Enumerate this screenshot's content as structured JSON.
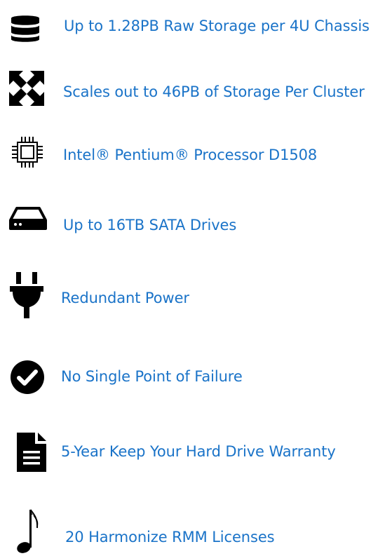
{
  "colors": {
    "label": "#1a73c8",
    "icon": "#000000"
  },
  "features": [
    {
      "icon": "database-icon",
      "label": "Up to 1.28PB Raw Storage per 4U Chassis"
    },
    {
      "icon": "expand-arrows-icon",
      "label": "Scales out to 46PB of Storage Per Cluster"
    },
    {
      "icon": "cpu-chip-icon",
      "label": "Intel® Pentium® Processor D1508"
    },
    {
      "icon": "hard-drive-icon",
      "label": "Up to 16TB SATA Drives"
    },
    {
      "icon": "power-plug-icon",
      "label": "Redundant Power"
    },
    {
      "icon": "check-circle-icon",
      "label": "No Single Point of Failure"
    },
    {
      "icon": "document-icon",
      "label": "5-Year Keep Your Hard Drive Warranty"
    },
    {
      "icon": "music-note-icon",
      "label": "20 Harmonize RMM Licenses"
    }
  ]
}
